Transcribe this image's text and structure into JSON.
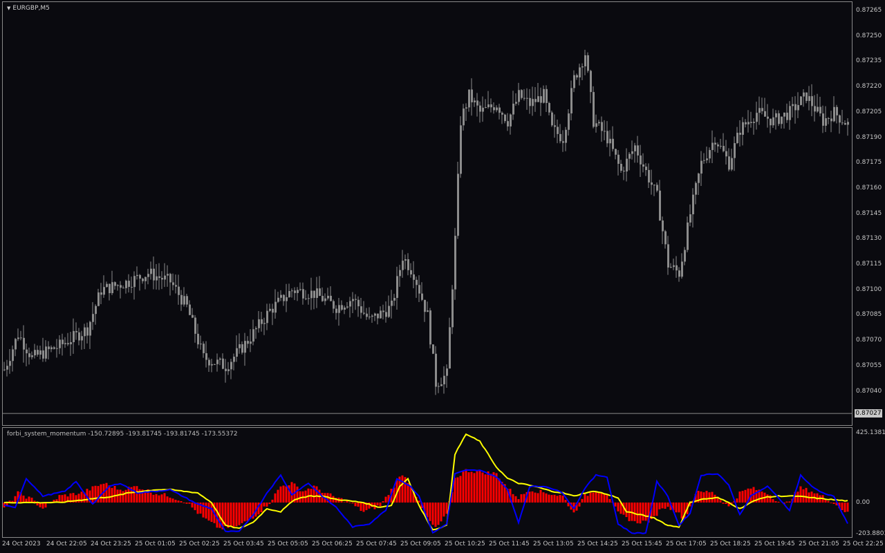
{
  "chart_title": "EURGBP,M5",
  "indicator": {
    "name": "forbi_system_momentum",
    "values": "-150.72895 -193.81745 -193.81745 -173.55372",
    "scale_top": "425.13816",
    "scale_zero": "0.00",
    "scale_bottom": "-203.8803"
  },
  "price_axis": [
    "0.87265",
    "0.87250",
    "0.87235",
    "0.87220",
    "0.87205",
    "0.87190",
    "0.87175",
    "0.87160",
    "0.87145",
    "0.87130",
    "0.87115",
    "0.87100",
    "0.87085",
    "0.87070",
    "0.87055",
    "0.87040",
    "0.87025"
  ],
  "current_price": "0.87027",
  "time_axis": [
    "24 Oct 2023",
    "24 Oct 22:05",
    "24 Oct 23:25",
    "25 Oct 01:05",
    "25 Oct 02:25",
    "25 Oct 03:45",
    "25 Oct 05:05",
    "25 Oct 06:25",
    "25 Oct 07:45",
    "25 Oct 09:05",
    "25 Oct 10:25",
    "25 Oct 11:45",
    "25 Oct 13:05",
    "25 Oct 14:25",
    "25 Oct 15:45",
    "25 Oct 17:05",
    "25 Oct 18:25",
    "25 Oct 19:45",
    "25 Oct 21:05",
    "25 Oct 22:25"
  ],
  "colors": {
    "background": "#0a0a0f",
    "candle": "#8c8c8c",
    "histogram": "#ff0000",
    "yellow_line": "#ffff00",
    "blue_line": "#0000ff"
  },
  "chart_data": {
    "type": "line",
    "price_close_keypoints": [
      [
        0,
        0.87053
      ],
      [
        5,
        0.87074
      ],
      [
        10,
        0.8706
      ],
      [
        20,
        0.87067
      ],
      [
        30,
        0.87077
      ],
      [
        35,
        0.871
      ],
      [
        45,
        0.87105
      ],
      [
        52,
        0.8711
      ],
      [
        60,
        0.87105
      ],
      [
        66,
        0.8709
      ],
      [
        72,
        0.8706
      ],
      [
        80,
        0.87055
      ],
      [
        88,
        0.8707
      ],
      [
        96,
        0.87088
      ],
      [
        104,
        0.871
      ],
      [
        112,
        0.87098
      ],
      [
        120,
        0.8709
      ],
      [
        126,
        0.87095
      ],
      [
        132,
        0.87082
      ],
      [
        140,
        0.8709
      ],
      [
        144,
        0.8712
      ],
      [
        148,
        0.8711
      ],
      [
        153,
        0.87085
      ],
      [
        156,
        0.87045
      ],
      [
        160,
        0.8705
      ],
      [
        163,
        0.8713
      ],
      [
        165,
        0.872
      ],
      [
        168,
        0.87215
      ],
      [
        172,
        0.87205
      ],
      [
        178,
        0.8721
      ],
      [
        182,
        0.872
      ],
      [
        186,
        0.87215
      ],
      [
        190,
        0.8721
      ],
      [
        195,
        0.87215
      ],
      [
        198,
        0.87195
      ],
      [
        202,
        0.8719
      ],
      [
        206,
        0.87225
      ],
      [
        210,
        0.8724
      ],
      [
        213,
        0.872
      ],
      [
        218,
        0.8719
      ],
      [
        223,
        0.8717
      ],
      [
        228,
        0.87185
      ],
      [
        232,
        0.8717
      ],
      [
        236,
        0.87155
      ],
      [
        240,
        0.87115
      ],
      [
        244,
        0.8711
      ],
      [
        248,
        0.87145
      ],
      [
        252,
        0.87175
      ],
      [
        257,
        0.8719
      ],
      [
        262,
        0.87175
      ],
      [
        266,
        0.87195
      ],
      [
        272,
        0.87205
      ],
      [
        278,
        0.872
      ],
      [
        284,
        0.87205
      ],
      [
        290,
        0.87215
      ],
      [
        296,
        0.872
      ],
      [
        300,
        0.87205
      ],
      [
        305,
        0.87198
      ]
    ],
    "indicator_yellow_keypoints": [
      [
        0,
        0
      ],
      [
        10,
        0
      ],
      [
        20,
        0
      ],
      [
        30,
        20
      ],
      [
        40,
        40
      ],
      [
        45,
        60
      ],
      [
        55,
        80
      ],
      [
        60,
        80
      ],
      [
        70,
        60
      ],
      [
        75,
        0
      ],
      [
        80,
        -150
      ],
      [
        85,
        -170
      ],
      [
        90,
        -130
      ],
      [
        95,
        -40
      ],
      [
        100,
        -60
      ],
      [
        105,
        20
      ],
      [
        110,
        40
      ],
      [
        115,
        40
      ],
      [
        120,
        20
      ],
      [
        125,
        10
      ],
      [
        130,
        0
      ],
      [
        135,
        -30
      ],
      [
        140,
        -20
      ],
      [
        143,
        100
      ],
      [
        146,
        150
      ],
      [
        150,
        -20
      ],
      [
        155,
        -180
      ],
      [
        160,
        -150
      ],
      [
        163,
        300
      ],
      [
        167,
        425
      ],
      [
        172,
        380
      ],
      [
        178,
        220
      ],
      [
        182,
        150
      ],
      [
        186,
        120
      ],
      [
        192,
        100
      ],
      [
        198,
        70
      ],
      [
        202,
        60
      ],
      [
        206,
        40
      ],
      [
        210,
        60
      ],
      [
        214,
        70
      ],
      [
        218,
        50
      ],
      [
        222,
        30
      ],
      [
        225,
        -60
      ],
      [
        230,
        -80
      ],
      [
        235,
        -100
      ],
      [
        240,
        -150
      ],
      [
        244,
        -160
      ],
      [
        248,
        0
      ],
      [
        252,
        20
      ],
      [
        258,
        30
      ],
      [
        262,
        0
      ],
      [
        266,
        -40
      ],
      [
        270,
        0
      ],
      [
        274,
        30
      ],
      [
        280,
        40
      ],
      [
        286,
        40
      ],
      [
        292,
        30
      ],
      [
        298,
        20
      ],
      [
        305,
        10
      ]
    ],
    "indicator_blue_keypoints": [
      [
        0,
        -20
      ],
      [
        4,
        -30
      ],
      [
        8,
        150
      ],
      [
        14,
        40
      ],
      [
        22,
        70
      ],
      [
        26,
        130
      ],
      [
        32,
        -10
      ],
      [
        38,
        100
      ],
      [
        42,
        120
      ],
      [
        48,
        60
      ],
      [
        55,
        70
      ],
      [
        60,
        80
      ],
      [
        70,
        -10
      ],
      [
        75,
        -40
      ],
      [
        80,
        -190
      ],
      [
        85,
        -190
      ],
      [
        90,
        -80
      ],
      [
        95,
        60
      ],
      [
        100,
        170
      ],
      [
        104,
        50
      ],
      [
        110,
        120
      ],
      [
        115,
        40
      ],
      [
        120,
        -30
      ],
      [
        126,
        -160
      ],
      [
        132,
        -140
      ],
      [
        138,
        -50
      ],
      [
        142,
        150
      ],
      [
        147,
        100
      ],
      [
        150,
        40
      ],
      [
        155,
        -200
      ],
      [
        160,
        -140
      ],
      [
        163,
        180
      ],
      [
        167,
        200
      ],
      [
        172,
        200
      ],
      [
        178,
        160
      ],
      [
        182,
        80
      ],
      [
        186,
        -130
      ],
      [
        190,
        100
      ],
      [
        196,
        100
      ],
      [
        202,
        60
      ],
      [
        206,
        -40
      ],
      [
        210,
        90
      ],
      [
        214,
        170
      ],
      [
        218,
        160
      ],
      [
        222,
        -140
      ],
      [
        227,
        -200
      ],
      [
        232,
        -200
      ],
      [
        236,
        130
      ],
      [
        240,
        40
      ],
      [
        244,
        -150
      ],
      [
        248,
        -70
      ],
      [
        252,
        170
      ],
      [
        258,
        180
      ],
      [
        262,
        110
      ],
      [
        266,
        -80
      ],
      [
        270,
        40
      ],
      [
        276,
        100
      ],
      [
        280,
        30
      ],
      [
        284,
        -50
      ],
      [
        288,
        170
      ],
      [
        292,
        100
      ],
      [
        296,
        60
      ],
      [
        300,
        40
      ],
      [
        305,
        -140
      ]
    ],
    "indicator_histogram_keypoints": [
      [
        0,
        -40
      ],
      [
        5,
        60
      ],
      [
        10,
        20
      ],
      [
        14,
        -40
      ],
      [
        20,
        40
      ],
      [
        28,
        60
      ],
      [
        36,
        120
      ],
      [
        42,
        80
      ],
      [
        48,
        100
      ],
      [
        54,
        60
      ],
      [
        60,
        40
      ],
      [
        66,
        0
      ],
      [
        72,
        -100
      ],
      [
        78,
        -170
      ],
      [
        84,
        -160
      ],
      [
        88,
        -120
      ],
      [
        92,
        -70
      ],
      [
        96,
        0
      ],
      [
        100,
        100
      ],
      [
        104,
        120
      ],
      [
        108,
        70
      ],
      [
        112,
        100
      ],
      [
        116,
        60
      ],
      [
        120,
        30
      ],
      [
        124,
        10
      ],
      [
        130,
        -60
      ],
      [
        136,
        -20
      ],
      [
        140,
        80
      ],
      [
        144,
        180
      ],
      [
        148,
        80
      ],
      [
        152,
        -80
      ],
      [
        156,
        -170
      ],
      [
        160,
        -80
      ],
      [
        163,
        150
      ],
      [
        167,
        200
      ],
      [
        172,
        190
      ],
      [
        178,
        180
      ],
      [
        182,
        90
      ],
      [
        186,
        30
      ],
      [
        190,
        80
      ],
      [
        196,
        60
      ],
      [
        202,
        40
      ],
      [
        206,
        -70
      ],
      [
        210,
        40
      ],
      [
        214,
        80
      ],
      [
        218,
        60
      ],
      [
        222,
        -70
      ],
      [
        228,
        -130
      ],
      [
        234,
        -120
      ],
      [
        238,
        -30
      ],
      [
        242,
        -40
      ],
      [
        246,
        -110
      ],
      [
        250,
        60
      ],
      [
        256,
        70
      ],
      [
        262,
        -30
      ],
      [
        266,
        60
      ],
      [
        270,
        90
      ],
      [
        276,
        60
      ],
      [
        282,
        -20
      ],
      [
        288,
        90
      ],
      [
        292,
        70
      ],
      [
        298,
        20
      ],
      [
        305,
        -70
      ]
    ]
  }
}
